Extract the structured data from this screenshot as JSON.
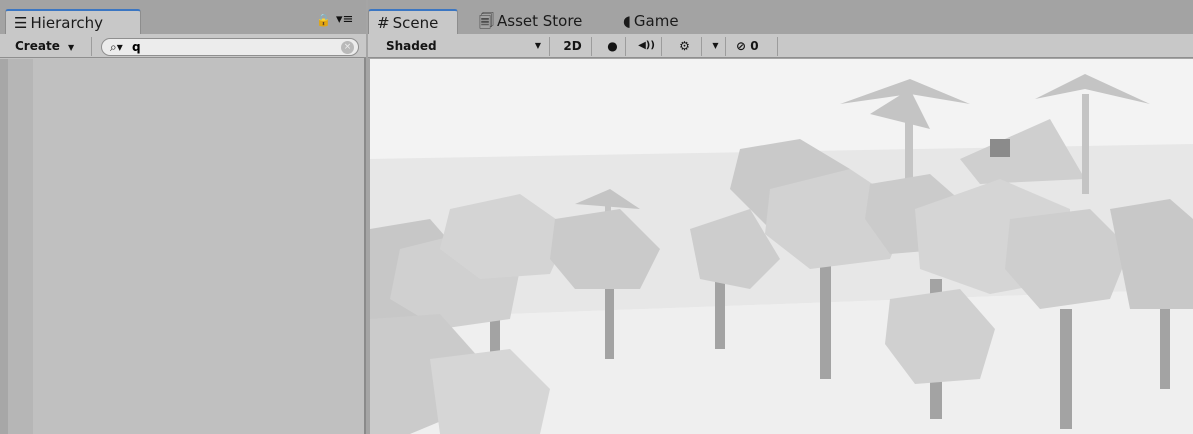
{
  "hierarchy": {
    "tab_label": "Hierarchy",
    "create_label": "Create",
    "search_value": "q"
  },
  "scene_tabs": [
    {
      "label": "Scene",
      "icon": "#"
    },
    {
      "label": "Asset Store",
      "icon": "store"
    },
    {
      "label": "Game",
      "icon": "pacman"
    }
  ],
  "scene_toolbar": {
    "shading_mode": "Shaded",
    "mode_2d_label": "2D",
    "hidden_count": "0"
  },
  "icons": {
    "hierarchy": "list-icon",
    "lock": "lock-icon",
    "menu": "menu-icon",
    "lighting": "lightbulb-icon",
    "audio": "audio-icon",
    "effects": "effects-icon",
    "visibility": "hidden-eye-icon"
  },
  "colors": {
    "active_tab_accent": "#3b76c2",
    "panel_bg": "#c2c2c2",
    "scene_sky": "#f3f3f3"
  }
}
